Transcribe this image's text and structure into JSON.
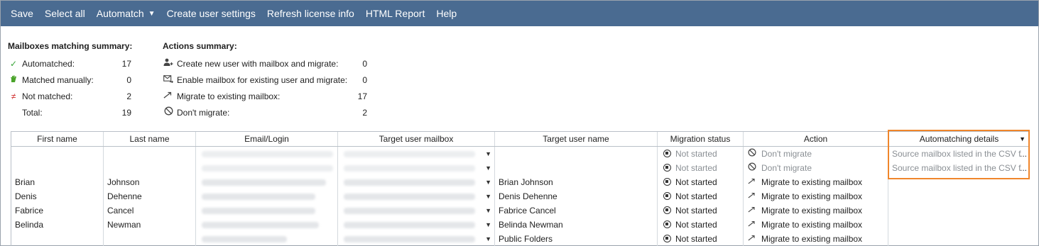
{
  "toolbar": {
    "save": "Save",
    "select_all": "Select all",
    "automatch": "Automatch",
    "create_user_settings": "Create user settings",
    "refresh_license": "Refresh license info",
    "html_report": "HTML Report",
    "help": "Help"
  },
  "matching_summary": {
    "title": "Mailboxes matching summary:",
    "rows": [
      {
        "label": "Automatched:",
        "value": "17",
        "icon": "check-icon"
      },
      {
        "label": "Matched manually:",
        "value": "0",
        "icon": "hand-icon"
      },
      {
        "label": "Not matched:",
        "value": "2",
        "icon": "not-equal-icon"
      },
      {
        "label": "Total:",
        "value": "19",
        "icon": ""
      }
    ]
  },
  "actions_summary": {
    "title": "Actions summary:",
    "rows": [
      {
        "label": "Create new user with mailbox and migrate:",
        "value": "0",
        "icon": "add-user-icon"
      },
      {
        "label": "Enable mailbox for existing user and migrate:",
        "value": "0",
        "icon": "mail-arrow-icon"
      },
      {
        "label": "Migrate to existing mailbox:",
        "value": "17",
        "icon": "migrate-arrow-icon"
      },
      {
        "label": "Don't migrate:",
        "value": "2",
        "icon": "block-icon"
      }
    ]
  },
  "grid": {
    "columns": {
      "first_name": "First name",
      "last_name": "Last name",
      "email": "Email/Login",
      "target_mailbox": "Target user mailbox",
      "target_name": "Target user name",
      "status": "Migration status",
      "action": "Action",
      "automatching": "Automatching details"
    },
    "rows": [
      {
        "first": "",
        "last": "",
        "target_name": "",
        "status": "Not started",
        "action": "Don't migrate",
        "details": "Source mailbox listed in the CSV f"
      },
      {
        "first": "",
        "last": "",
        "target_name": "",
        "status": "Not started",
        "action": "Don't migrate",
        "details": "Source mailbox listed in the CSV f"
      },
      {
        "first": "Brian",
        "last": "Johnson",
        "target_name": "Brian Johnson",
        "status": "Not started",
        "action": "Migrate to existing mailbox",
        "details": ""
      },
      {
        "first": "Denis",
        "last": "Dehenne",
        "target_name": "Denis Dehenne",
        "status": "Not started",
        "action": "Migrate to existing mailbox",
        "details": ""
      },
      {
        "first": "Fabrice",
        "last": "Cancel",
        "target_name": "Fabrice Cancel",
        "status": "Not started",
        "action": "Migrate to existing mailbox",
        "details": ""
      },
      {
        "first": "Belinda",
        "last": "Newman",
        "target_name": "Belinda Newman",
        "status": "Not started",
        "action": "Migrate to existing mailbox",
        "details": ""
      },
      {
        "first": "",
        "last": "",
        "target_name": "Public Folders",
        "status": "Not started",
        "action": "Migrate to existing mailbox",
        "details": ""
      }
    ]
  },
  "colors": {
    "toolbar_bg": "#4a6b91",
    "highlight": "#f0862b"
  }
}
